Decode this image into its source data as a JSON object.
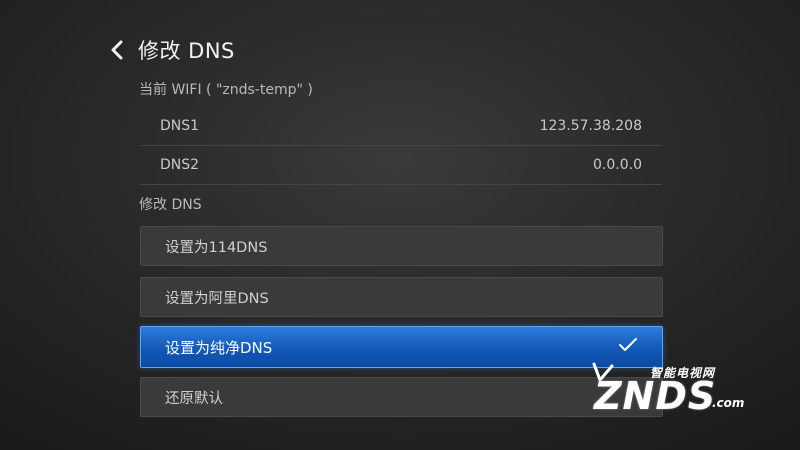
{
  "header": {
    "back_icon": "chevron-left-icon",
    "title": "修改 DNS"
  },
  "current_wifi": {
    "label": "当前 WIFI ( \"znds-temp\" )"
  },
  "dns_info": [
    {
      "name": "DNS1",
      "value": "123.57.38.208"
    },
    {
      "name": "DNS2",
      "value": "0.0.0.0"
    }
  ],
  "modify_section": {
    "label": "修改 DNS",
    "options": [
      {
        "label": "设置为114DNS",
        "selected": false
      },
      {
        "label": "设置为阿里DNS",
        "selected": false
      },
      {
        "label": "设置为纯净DNS",
        "selected": true
      },
      {
        "label": "还原默认",
        "selected": false
      }
    ],
    "selected_icon": "check-icon"
  },
  "watermark": {
    "cn_text": "智能电视网",
    "brand": "ZNDS",
    "suffix": ".com"
  },
  "colors": {
    "background": "#2a2a2a",
    "selected_option": "#1a66c8",
    "option_bg": "#3a3a3a"
  }
}
